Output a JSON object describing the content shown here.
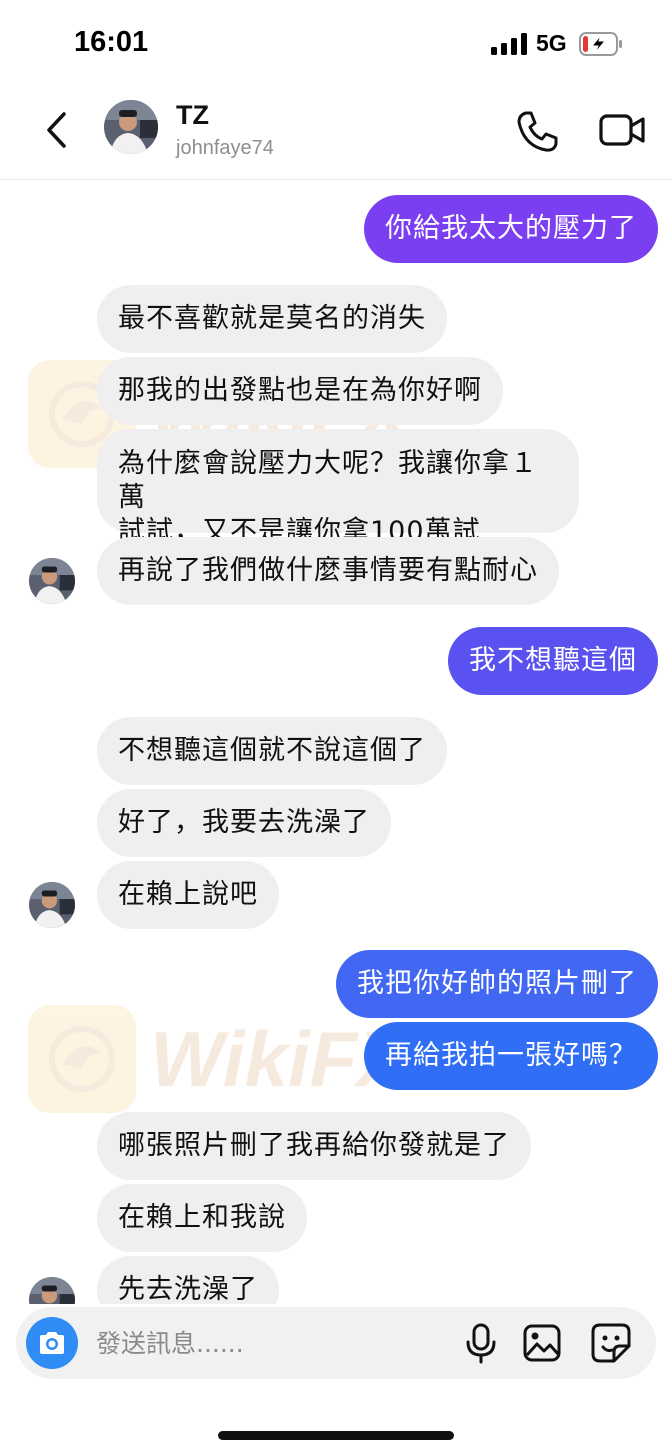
{
  "status_bar": {
    "time": "16:01",
    "network": "5G",
    "battery_state": "charging-low",
    "battery_color": "#e53935"
  },
  "header": {
    "back_icon": "chevron-left-icon",
    "contact_name": "TZ",
    "contact_username": "johnfaye74",
    "call_icon": "phone-icon",
    "video_icon": "video-camera-icon"
  },
  "colors": {
    "incoming_bubble": "#efefef",
    "outgoing_purple": "#7b3ff2",
    "outgoing_blue": "#2f6ef5",
    "camera_button": "#2f8df5"
  },
  "messages": [
    {
      "side": "out",
      "text": "你給我太大的壓力了"
    },
    {
      "side": "in",
      "text": "最不喜歡就是莫名的消失"
    },
    {
      "side": "in",
      "text": "那我的出發點也是在為你好啊"
    },
    {
      "side": "in",
      "lines": [
        "為什麼會說壓力大呢？我讓你拿１萬",
        "試試，又不是讓你拿100萬試"
      ]
    },
    {
      "side": "in",
      "text": "再說了我們做什麼事情要有點耐心"
    },
    {
      "side": "out",
      "text": "我不想聽這個"
    },
    {
      "side": "in",
      "text": "不想聽這個就不說這個了"
    },
    {
      "side": "in",
      "text": "好了，我要去洗澡了"
    },
    {
      "side": "in",
      "text": "在賴上說吧"
    },
    {
      "side": "out",
      "text": "我把你好帥的照片刪了"
    },
    {
      "side": "out",
      "text": "再給我拍一張好嗎？"
    },
    {
      "side": "in",
      "text": "哪張照片刪了我再給你發就是了"
    },
    {
      "side": "in",
      "text": "在賴上和我說"
    },
    {
      "side": "in",
      "text": "先去洗澡了"
    }
  ],
  "watermark": {
    "text": "WikiFX",
    "logo_icon": "wikifx-eagle-logo"
  },
  "composer": {
    "camera_icon": "camera-icon",
    "placeholder": "發送訊息......",
    "mic_icon": "microphone-icon",
    "gallery_icon": "image-gallery-icon",
    "sticker_icon": "sticker-icon"
  }
}
